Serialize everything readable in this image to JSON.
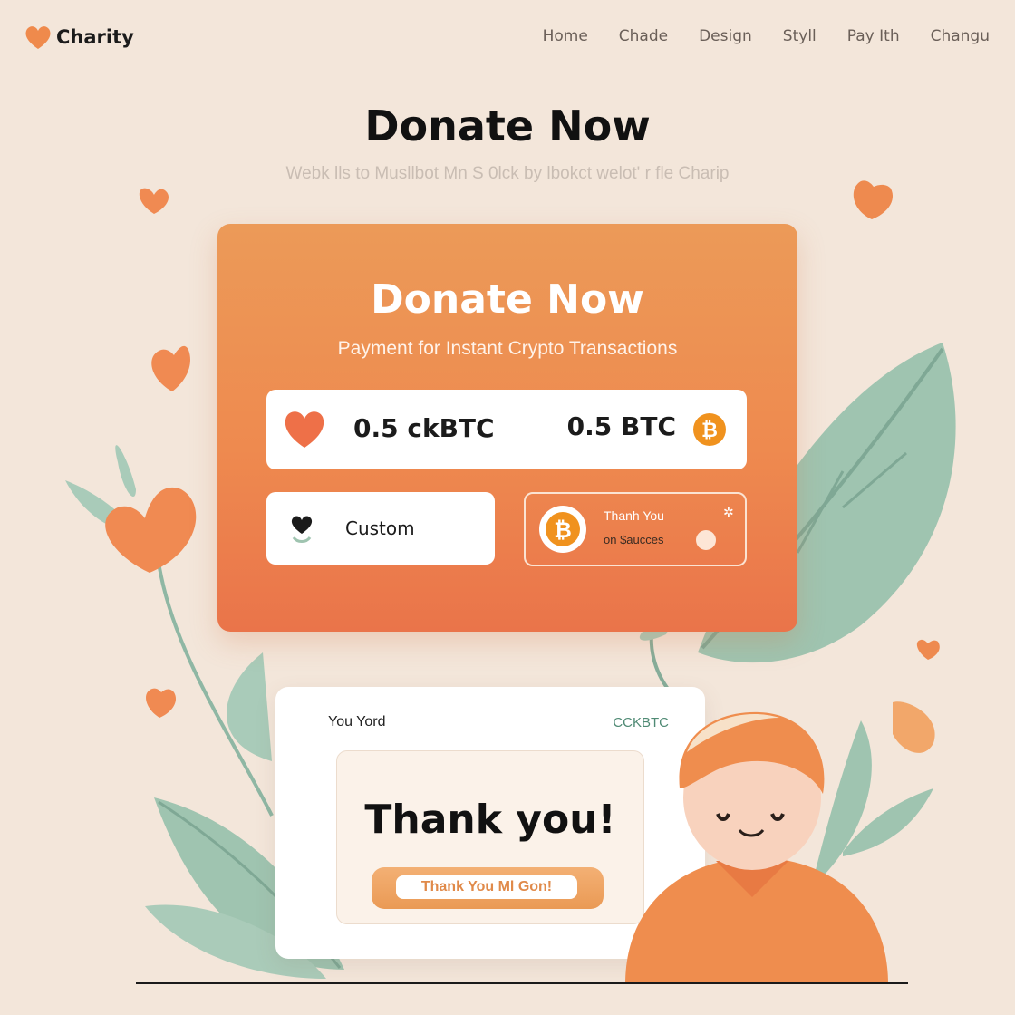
{
  "header": {
    "logo_text": "Charity",
    "nav": [
      "Home",
      "Chade",
      "Design",
      "Styll",
      "Pay Ith",
      "Changu"
    ]
  },
  "hero": {
    "title": "Donate Now",
    "subtitle": "Webk lls to Musllbot Mn S 0lck by lbokct welot' r fle Charip"
  },
  "donate_card": {
    "title": "Donate Now",
    "subtitle": "Payment for Instant Crypto Transactions",
    "amount_ckbtc": "0.5 ckBTC",
    "amount_btc": "0.5 BTC",
    "custom_label": "Custom",
    "thanks_line1": "Thanh You",
    "thanks_line2": "on $aucces"
  },
  "confirmation": {
    "label": "You Yord",
    "token": "CCKBTC",
    "title": "Thank you!",
    "button_label": "Thank You Ml Gon!"
  },
  "colors": {
    "accent_orange": "#ee8a4f",
    "leaf_green": "#9cc4b0",
    "background": "#f3e6da"
  }
}
